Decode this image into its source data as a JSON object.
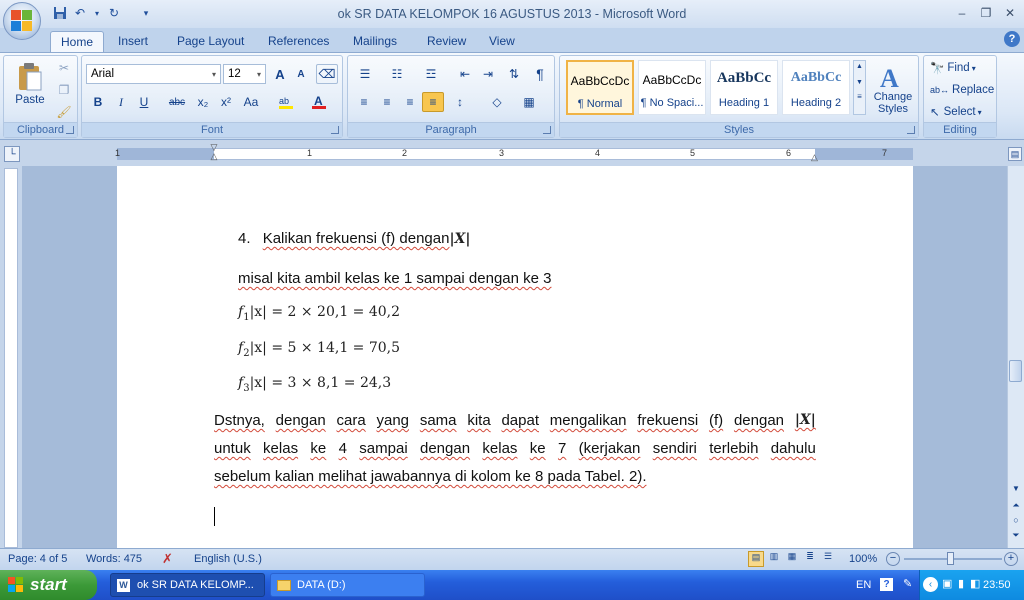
{
  "window": {
    "title": "ok SR DATA KELOMPOK 16 AGUSTUS 2013 - Microsoft Word",
    "minimize": "–",
    "restore": "❐",
    "close": "✕"
  },
  "tabs": [
    "Home",
    "Insert",
    "Page Layout",
    "References",
    "Mailings",
    "Review",
    "View"
  ],
  "ribbon": {
    "clipboard": {
      "label": "Clipboard",
      "paste": "Paste"
    },
    "font": {
      "label": "Font",
      "name": "Arial",
      "size": "12",
      "bold": "B",
      "italic": "I",
      "underline": "U",
      "strike": "abc",
      "sub": "x₂",
      "sup": "x²",
      "case": "Aa",
      "grow": "A",
      "shrink": "A"
    },
    "paragraph": {
      "label": "Paragraph",
      "pilcrow": "¶"
    },
    "styles": {
      "label": "Styles",
      "items": [
        {
          "sample": "AaBbCcDc",
          "name": "¶ Normal"
        },
        {
          "sample": "AaBbCcDc",
          "name": "¶ No Spaci..."
        },
        {
          "sample": "AaBbCc",
          "name": "Heading 1"
        },
        {
          "sample": "AaBbCc",
          "name": "Heading 2"
        }
      ],
      "change_styles": "Change Styles"
    },
    "editing": {
      "label": "Editing",
      "find": "Find",
      "replace": "Replace",
      "select": "Select"
    }
  },
  "ruler": {
    "numbers": [
      "1",
      "1",
      "2",
      "3",
      "4",
      "5",
      "6",
      "7"
    ]
  },
  "document": {
    "item_number": "4.",
    "item_text": "Kalikan frekuensi (f) dengan",
    "item_var": "|X|",
    "example_line": "misal kita ambil kelas ke 1 sampai dengan ke 3",
    "formulas": [
      {
        "f": "f",
        "sub": "1",
        "rest": "|x| = 2 × 20,1 = 40,2"
      },
      {
        "f": "f",
        "sub": "2",
        "rest": "|x| = 5 × 14,1 = 70,5"
      },
      {
        "f": "f",
        "sub": "3",
        "rest": "|x| = 3 × 8,1 = 24,3"
      }
    ],
    "paragraph_lines": [
      [
        "Dstnya,",
        "dengan",
        "cara",
        "yang",
        "sama",
        "kita",
        "dapat",
        "mengalikan",
        "frekuensi",
        "(f)",
        "dengan",
        "|X|"
      ],
      [
        "untuk",
        "kelas",
        "ke",
        "4",
        "sampai",
        "dengan",
        "kelas",
        "ke",
        "7",
        "(kerjakan",
        "sendiri",
        "terlebih",
        "dahulu"
      ],
      "sebelum kalian melihat jawabannya di kolom ke 8 pada Tabel. 2)."
    ]
  },
  "status": {
    "page": "Page: 4 of 5",
    "words": "Words: 475",
    "language": "English (U.S.)",
    "zoom": "100%"
  },
  "taskbar": {
    "start": "start",
    "tasks": [
      "ok SR DATA KELOMP...",
      "DATA (D:)"
    ],
    "lang": "EN",
    "time": "23:50"
  },
  "colors": {
    "ribbon_bg": "#dbe7f6",
    "accent_text": "#15428b",
    "taskbar": "#245edb",
    "start": "#3c9a38",
    "selected_style": "#f0b346"
  }
}
